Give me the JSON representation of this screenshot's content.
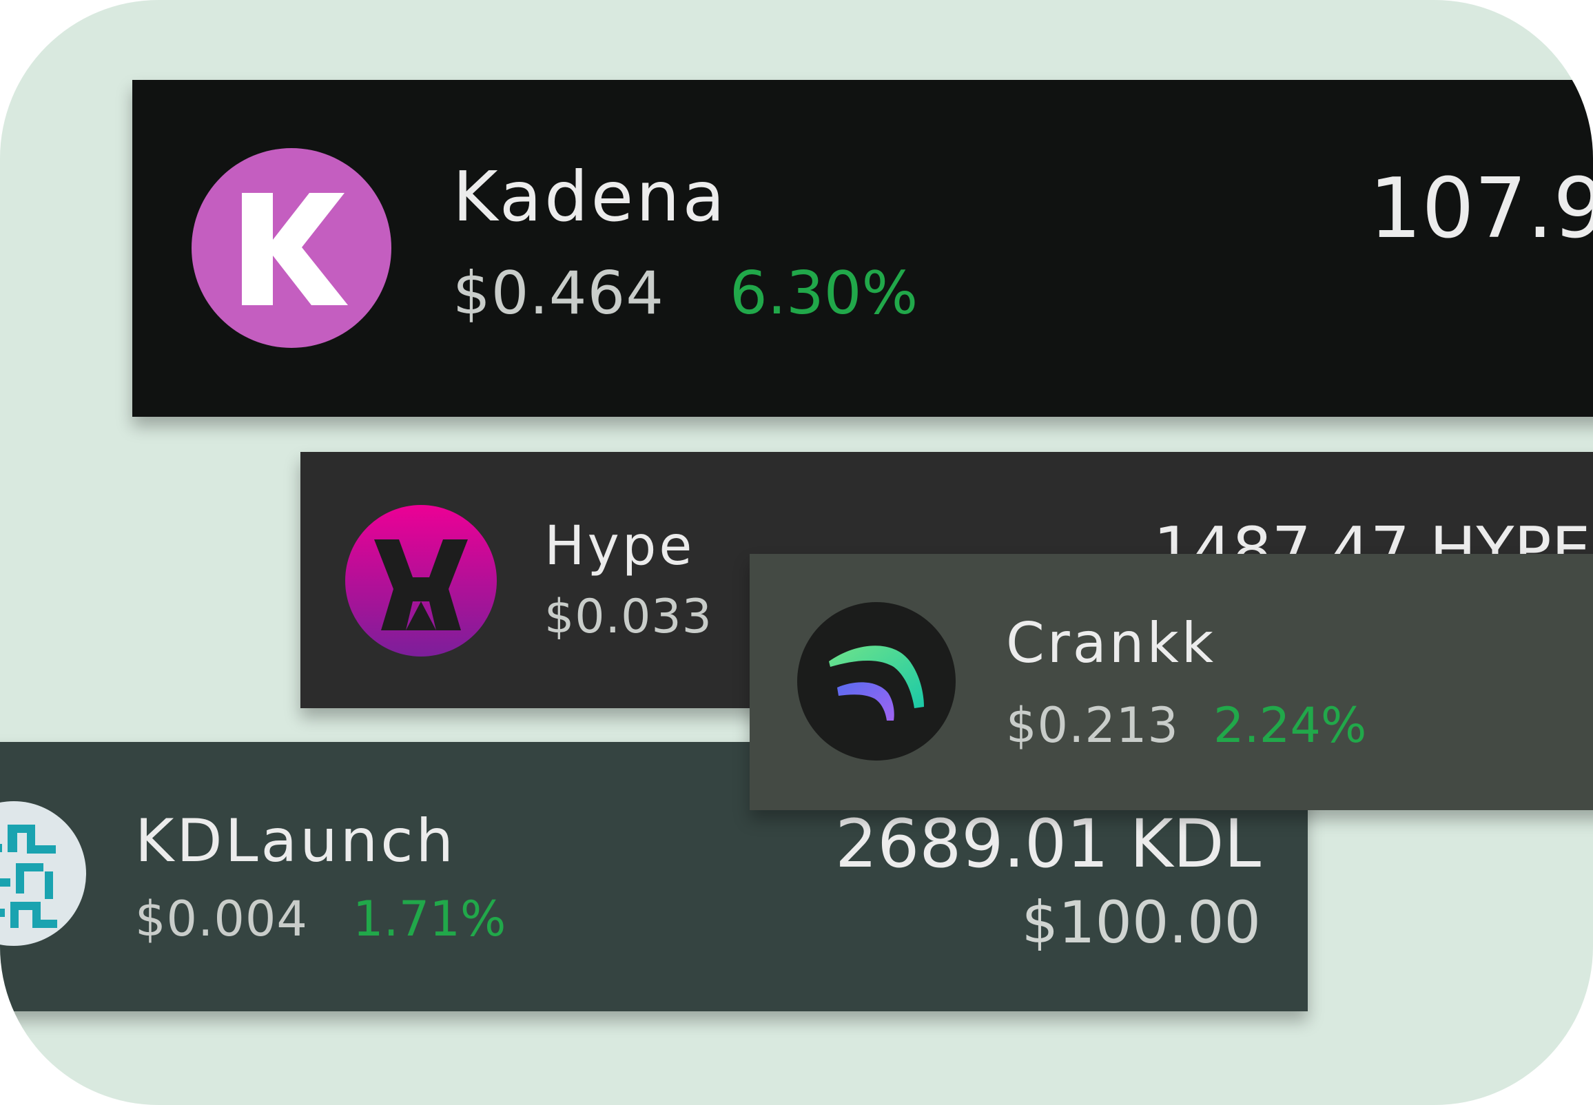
{
  "tokens": [
    {
      "name": "Kadena",
      "price": "$0.464",
      "change": "6.30%",
      "amount": "107.9",
      "icon": "kadena-logo-icon"
    },
    {
      "name": "Hype",
      "price": "$0.033",
      "amount": "1487.47 HYPE",
      "icon": "hype-logo-icon"
    },
    {
      "name": "Crankk",
      "price": "$0.213",
      "change": "2.24%",
      "icon": "crankk-logo-icon"
    },
    {
      "name": "KDLaunch",
      "price": "$0.004",
      "change": "1.71%",
      "amount": "2689.01 KDL",
      "usd_value": "$100.00",
      "icon": "kdlaunch-logo-icon"
    }
  ],
  "colors": {
    "background": "#d9e9df",
    "positive_change": "#21a84a",
    "kadena_card": "#101211",
    "hype_card": "#2c2c2c",
    "crankk_card": "#444a44",
    "kdlaunch_card": "#354441"
  }
}
